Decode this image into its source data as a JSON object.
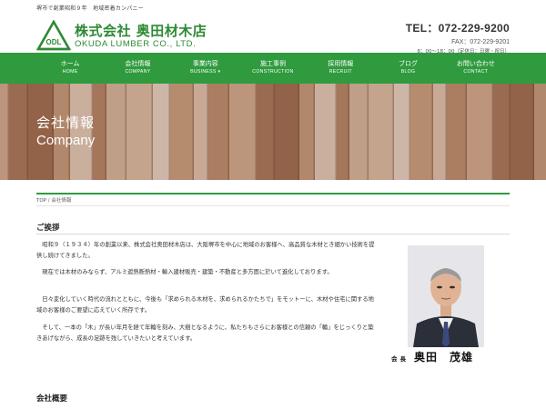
{
  "topbar": {
    "tagline": "堺市で創業昭和９年　地域密着カンパニー"
  },
  "logo": {
    "mark_letters": "ODL",
    "company_name_jp": "株式会社 奥田材木店",
    "company_name_en": "OKUDA LUMBER CO., LTD."
  },
  "contact": {
    "tel": "TEL：072-229-9200",
    "fax": "FAX：072-229-9201",
    "hours": "8：00～18：00（定休日：日曜・祝日）"
  },
  "nav": [
    {
      "jp": "ホーム",
      "en": "HOME"
    },
    {
      "jp": "会社情報",
      "en": "COMPANY"
    },
    {
      "jp": "事業内容",
      "en": "BUSINESS ▾"
    },
    {
      "jp": "施工事例",
      "en": "CONSTRUCTION"
    },
    {
      "jp": "採用情報",
      "en": "RECRUIT"
    },
    {
      "jp": "ブログ",
      "en": "BLOG"
    },
    {
      "jp": "お問い合わせ",
      "en": "CONTACT"
    }
  ],
  "hero": {
    "title_jp": "会社情報",
    "title_en": "Company"
  },
  "breadcrumb": {
    "home": "TOP",
    "separator": "/",
    "current": "会社情報"
  },
  "greeting": {
    "heading": "ご挨拶",
    "paragraphs": [
      "　昭和９（１９３４）年の創業以来、株式会社奥田材木店は、大阪堺市を中心に地域のお客様へ、高品質な木材とき細かい技術を提供し続けてきました。",
      "　現在では木材のみならず、アルミ遮熱断熱材・輸入建材販売・建築・不動産と多方面に於いて進化しております。",
      "　日々変化していく時代の流れとともに、今後も「求められる木材を、求められるかたちで」をモットーに、木材や住宅に関する地域のお客様のご要望に応えていく所存です。",
      "　そして、一本の「木」が長い年月を経て年輪を刻み、大樹となるように、私たちもさらにお客様との信頼の「輪」をじっくりと築きあげながら、成長の足跡を残していきたいと考えています。"
    ],
    "signature_role": "会長",
    "signature_name": "奥田　茂雄"
  },
  "overview": {
    "heading": "会社概要"
  },
  "colors": {
    "brand_green": "#2f9b3e",
    "logo_green": "#2d8a34"
  }
}
